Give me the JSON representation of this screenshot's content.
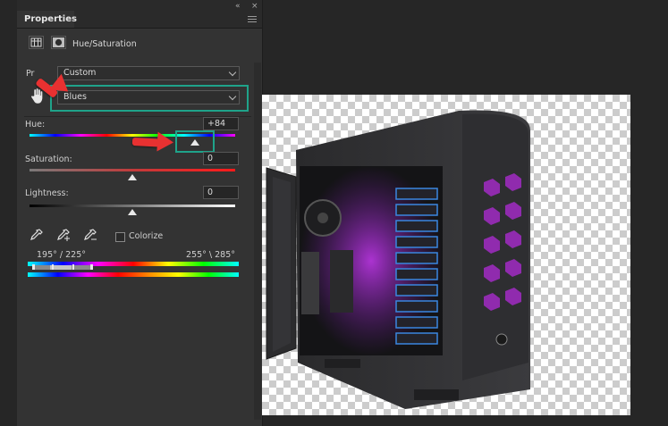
{
  "panel": {
    "tab_label": "Properties",
    "collapse_glyph": "«",
    "close_glyph": "×",
    "adjustment_title": "Hue/Saturation"
  },
  "preset": {
    "label": "Pr",
    "value": "Custom"
  },
  "channel": {
    "value": "Blues"
  },
  "hue": {
    "label": "Hue:",
    "value": "+84"
  },
  "saturation": {
    "label": "Saturation:",
    "value": "0"
  },
  "lightness": {
    "label": "Lightness:",
    "value": "0"
  },
  "colorize": {
    "label": "Colorize",
    "checked": false
  },
  "range": {
    "left_text": "195° / 225°",
    "right_text": "255° \\ 285°"
  },
  "colors": {
    "panel_bg": "#333333",
    "highlight_box": "#1fa38a",
    "annotation_arrow": "#e83131"
  },
  "icons": [
    "collapse-icon",
    "close-icon",
    "panel-menu-icon",
    "adjustment-layer-icon",
    "mask-icon",
    "targeted-adjustment-hand-icon",
    "eyedropper-icon",
    "eyedropper-plus-icon",
    "eyedropper-minus-icon"
  ]
}
